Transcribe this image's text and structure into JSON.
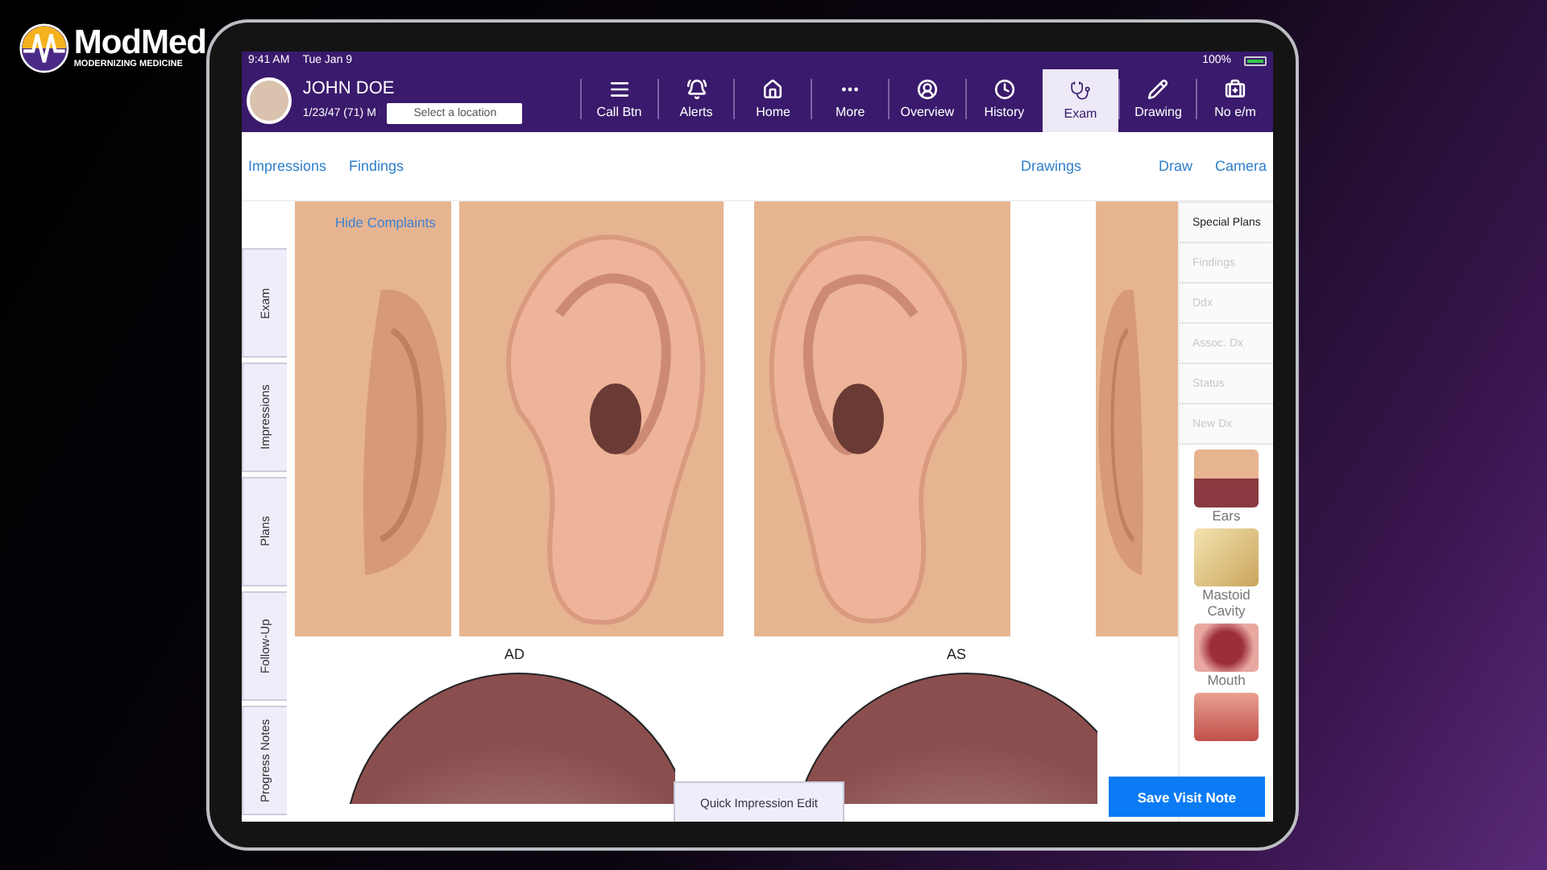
{
  "brand": {
    "name": "ModMed",
    "tagline": "MODERNIZING MEDICINE"
  },
  "status_bar": {
    "time": "9:41 AM",
    "date": "Tue Jan 9",
    "battery": "100%"
  },
  "patient": {
    "name": "JOHN DOE",
    "dob": "1/23/47 (71) M",
    "location": {
      "placeholder": "Select a location"
    }
  },
  "nav": [
    {
      "label": "Call Btn",
      "kind": "list",
      "selected": false
    },
    {
      "label": "Alerts",
      "kind": "bell",
      "selected": false
    },
    {
      "label": "Home",
      "kind": "home",
      "selected": false
    },
    {
      "label": "More",
      "kind": "more",
      "selected": false
    },
    {
      "label": "Overview",
      "kind": "user",
      "selected": false
    },
    {
      "label": "History",
      "kind": "clock",
      "selected": false
    },
    {
      "label": "Exam",
      "kind": "stethoscope",
      "selected": true
    },
    {
      "label": "Drawing",
      "kind": "pencil",
      "selected": false
    },
    {
      "label": "No e/m",
      "kind": "medical",
      "selected": false
    }
  ],
  "subnav": {
    "left": [
      "Impressions",
      "Findings"
    ],
    "right": [
      "Drawings",
      "Draw",
      "Camera"
    ]
  },
  "hide_complaints": "Hide Complaints",
  "side_tabs": [
    "Exam",
    "Impressions",
    "Plans",
    "Follow-Up",
    "Progress Notes"
  ],
  "ear_views": [
    {
      "label": "AD"
    },
    {
      "label": "AS"
    }
  ],
  "right_panel": {
    "tabs": [
      {
        "label": "Special Plans",
        "disabled": false
      },
      {
        "label": "Findings",
        "disabled": true
      },
      {
        "label": "Ddx",
        "disabled": true
      },
      {
        "label": "Assoc. Dx",
        "disabled": true
      },
      {
        "label": "Status",
        "disabled": true
      },
      {
        "label": "New Dx",
        "disabled": true
      }
    ],
    "thumbnails": [
      {
        "label": "Ears",
        "kind": "ears"
      },
      {
        "label": "Mastoid Cavity",
        "kind": "mastoid"
      },
      {
        "label": "Mouth",
        "kind": "mouth"
      }
    ]
  },
  "quick_edit": "Quick Impression Edit",
  "save_button": "Save Visit Note"
}
